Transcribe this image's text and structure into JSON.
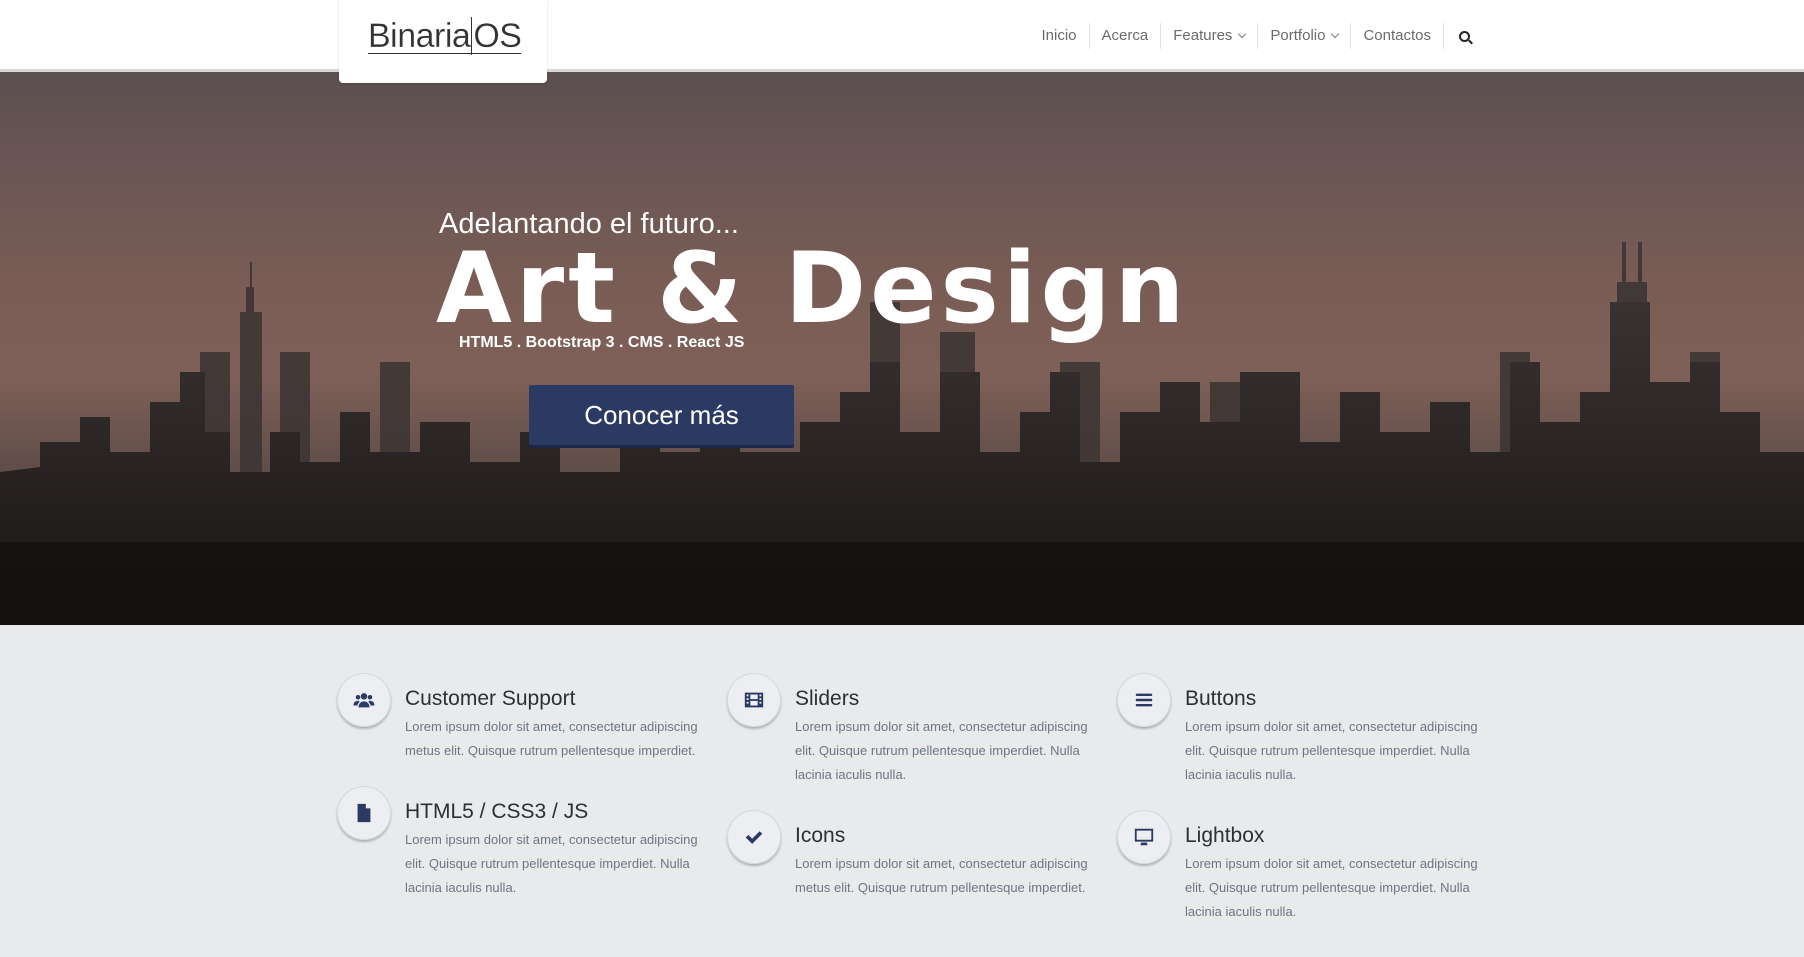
{
  "brand": {
    "logo_part1": "Binaria",
    "logo_part2": "OS"
  },
  "nav": {
    "items": [
      {
        "label": "Inicio"
      },
      {
        "label": "Acerca"
      },
      {
        "label": "Features"
      },
      {
        "label": "Portfolio"
      },
      {
        "label": "Contactos"
      }
    ],
    "search_icon": "search-icon"
  },
  "hero": {
    "subtitle": "Adelantando el futuro...",
    "title": "Art & Design",
    "tags": "HTML5 . Bootstrap 3 . CMS . React JS",
    "cta_label": "Conocer más"
  },
  "colors": {
    "accent": "#2b3a63",
    "features_bg": "#e9eaec"
  },
  "features": [
    {
      "icon": "users-icon",
      "title": "Customer Support",
      "text": "Lorem ipsum dolor sit amet, consectetur adipiscing metus elit. Quisque rutrum pellentesque imperdiet."
    },
    {
      "icon": "film-icon",
      "title": "Sliders",
      "text": "Lorem ipsum dolor sit amet, consectetur adipiscing elit. Quisque rutrum pellentesque imperdiet. Nulla lacinia iaculis nulla."
    },
    {
      "icon": "bars-icon",
      "title": "Buttons",
      "text": "Lorem ipsum dolor sit amet, consectetur adipiscing elit. Quisque rutrum pellentesque imperdiet. Nulla lacinia iaculis nulla."
    },
    {
      "icon": "file-icon",
      "title": "HTML5 / CSS3 / JS",
      "text": "Lorem ipsum dolor sit amet, consectetur adipiscing elit. Quisque rutrum pellentesque imperdiet. Nulla lacinia iaculis nulla."
    },
    {
      "icon": "check-icon",
      "title": "Icons",
      "text": "Lorem ipsum dolor sit amet, consectetur adipiscing metus elit. Quisque rutrum pellentesque imperdiet."
    },
    {
      "icon": "desktop-icon",
      "title": "Lightbox",
      "text": "Lorem ipsum dolor sit amet, consectetur adipiscing elit. Quisque rutrum pellentesque imperdiet. Nulla lacinia iaculis nulla."
    }
  ]
}
